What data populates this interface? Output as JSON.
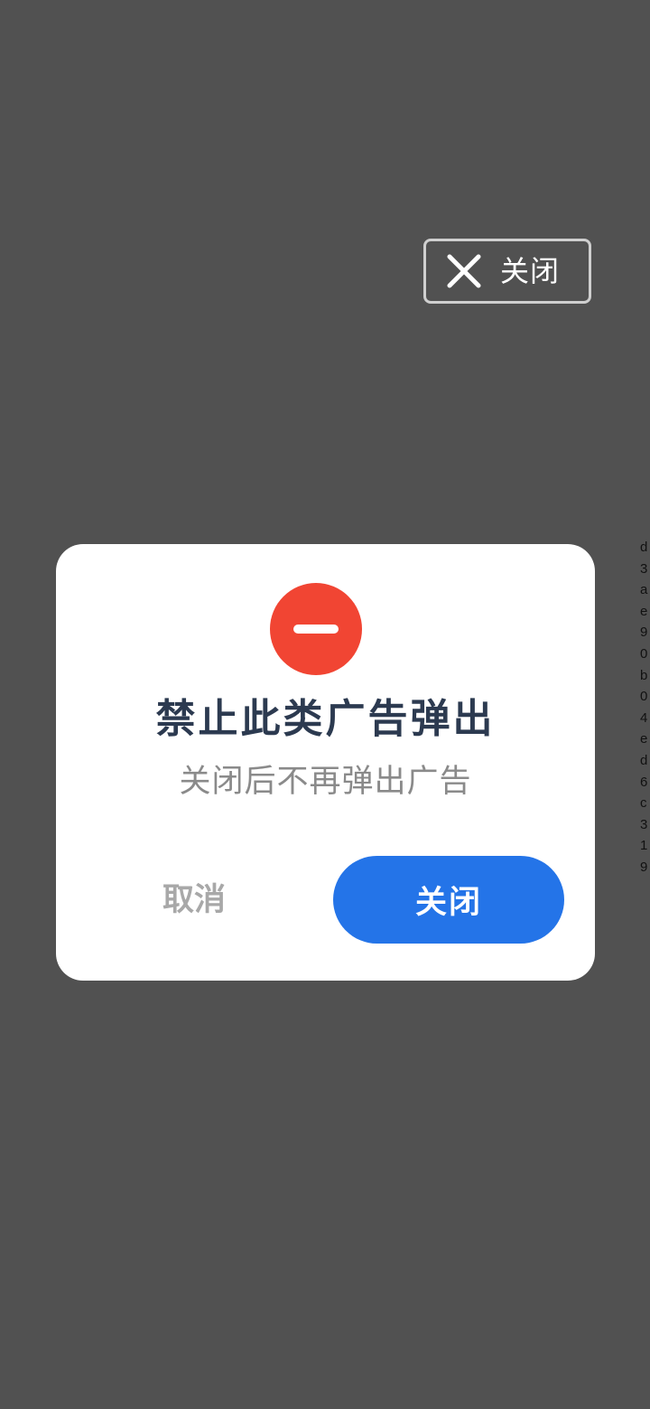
{
  "overlay_close": {
    "label": "关闭",
    "icon": "close-icon"
  },
  "side_text": [
    "d",
    "3",
    "a",
    "e",
    "9",
    "0",
    "b",
    "0",
    "4",
    "e",
    "d",
    "6",
    "c",
    "3",
    "1",
    "9"
  ],
  "dialog": {
    "icon": "block-icon",
    "title": "禁止此类广告弹出",
    "subtitle": "关闭后不再弹出广告",
    "cancel_label": "取消",
    "confirm_label": "关闭"
  },
  "colors": {
    "background": "#515151",
    "dialog_background": "#ffffff",
    "icon_red": "#f14533",
    "title": "#2c3a50",
    "subtitle": "#8a8a8a",
    "cancel_text": "#a8a8a8",
    "confirm_background": "#2474e8"
  }
}
